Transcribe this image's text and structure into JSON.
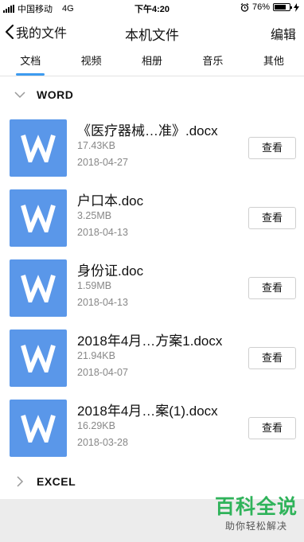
{
  "status_bar": {
    "carrier": "中国移动",
    "network": "4G",
    "time": "下午4:20",
    "battery": "76%",
    "battery_level": 0.76
  },
  "nav": {
    "back_label": "我的文件",
    "title": "本机文件",
    "edit_label": "编辑"
  },
  "tabs": [
    "文档",
    "视频",
    "相册",
    "音乐",
    "其他"
  ],
  "active_tab": 0,
  "groups": {
    "word": {
      "name": "WORD",
      "files": [
        {
          "name": "《医疗器械…准》.docx",
          "size": "17.43KB",
          "date": "2018-04-27",
          "action": "查看"
        },
        {
          "name": "户口本.doc",
          "size": "3.25MB",
          "date": "2018-04-13",
          "action": "查看"
        },
        {
          "name": "身份证.doc",
          "size": "1.59MB",
          "date": "2018-04-13",
          "action": "查看"
        },
        {
          "name": "2018年4月…方案1.docx",
          "size": "21.94KB",
          "date": "2018-04-07",
          "action": "查看"
        },
        {
          "name": "2018年4月…案(1).docx",
          "size": "16.29KB",
          "date": "2018-03-28",
          "action": "查看"
        }
      ]
    },
    "excel": {
      "name": "EXCEL"
    }
  },
  "watermark": {
    "title": "百科全说",
    "subtitle": "助你轻松解决"
  },
  "colors": {
    "accent": "#3d9bf0",
    "word_icon": "#5a97e9",
    "watermark": "#2fb35a"
  }
}
